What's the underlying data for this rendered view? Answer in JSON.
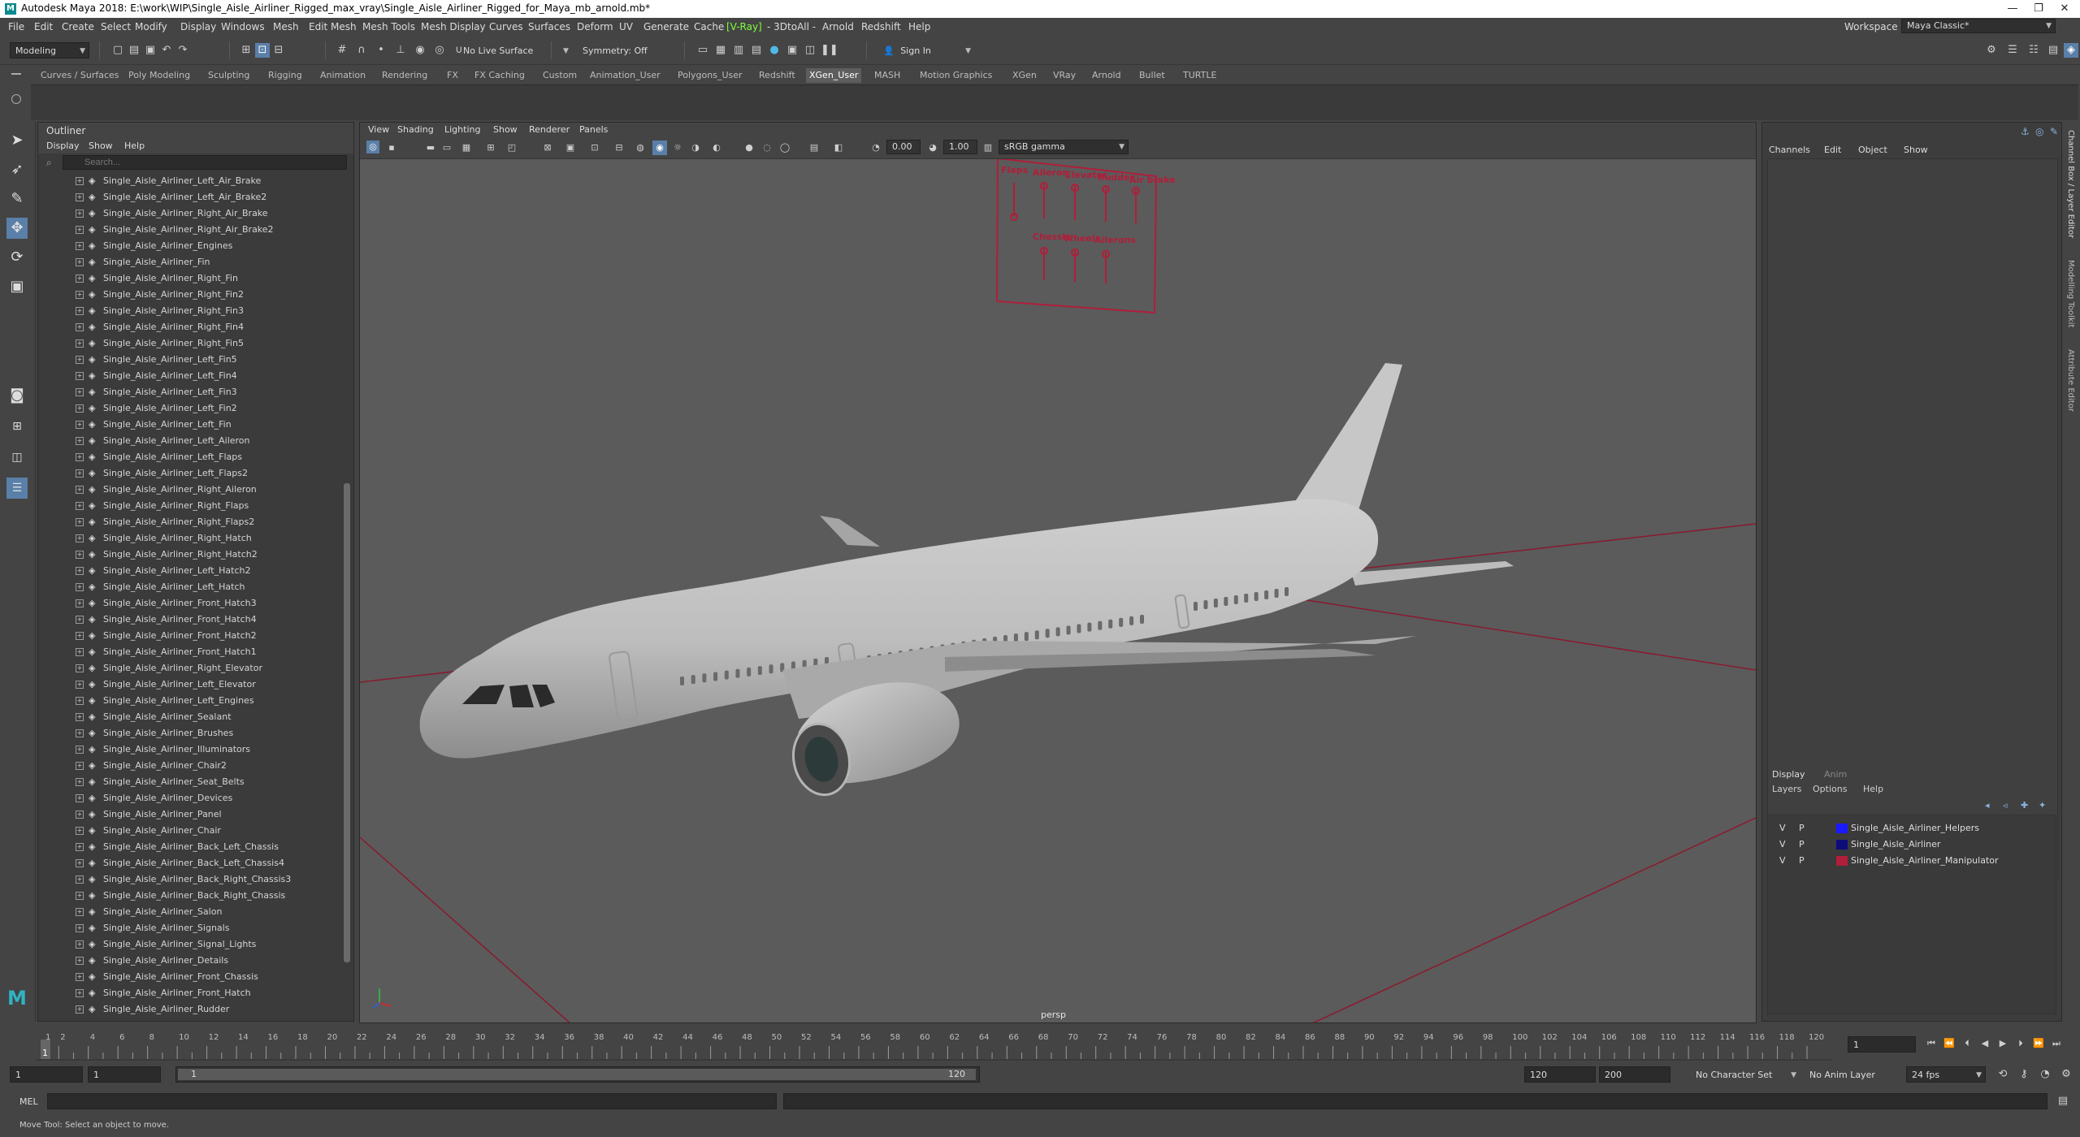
{
  "titlebar": {
    "title": "Autodesk Maya 2018: E:\\work\\WIP\\Single_Aisle_Airliner_Rigged_max_vray\\Single_Aisle_Airliner_Rigged_for_Maya_mb_arnold.mb*",
    "logo": "M",
    "minimize": "—",
    "restore": "❐",
    "close": "✕"
  },
  "menubar": {
    "items": [
      "File",
      "Edit",
      "Create",
      "Select",
      "Modify",
      "Display",
      "Windows",
      "Mesh",
      "Edit Mesh",
      "Mesh Tools",
      "Mesh Display",
      "Curves",
      "Surfaces",
      "Deform",
      "UV",
      "Generate",
      "Cache",
      "[V-Ray]",
      "- 3DtoAll -",
      "Arnold",
      "Redshift",
      "Help"
    ],
    "workspace_label": "Workspace :",
    "workspace_value": "Maya Classic*"
  },
  "statusline": {
    "mode": "Modeling",
    "live_surface": "No Live Surface",
    "symmetry": "Symmetry: Off",
    "sign_in": "Sign In"
  },
  "shelf": {
    "tabs": [
      "Curves / Surfaces",
      "Poly Modeling",
      "Sculpting",
      "Rigging",
      "Animation",
      "Rendering",
      "FX",
      "FX Caching",
      "Custom",
      "Animation_User",
      "Polygons_User",
      "Redshift",
      "XGen_User",
      "MASH",
      "Motion Graphics",
      "XGen",
      "VRay",
      "Arnold",
      "Bullet",
      "TURTLE"
    ],
    "active": "XGen_User"
  },
  "outliner": {
    "title": "Outliner",
    "menu": [
      "Display",
      "Show",
      "Help"
    ],
    "search_placeholder": "Search...",
    "items": [
      "Single_Aisle_Airliner_Left_Air_Brake",
      "Single_Aisle_Airliner_Left_Air_Brake2",
      "Single_Aisle_Airliner_Right_Air_Brake",
      "Single_Aisle_Airliner_Right_Air_Brake2",
      "Single_Aisle_Airliner_Engines",
      "Single_Aisle_Airliner_Fin",
      "Single_Aisle_Airliner_Right_Fin",
      "Single_Aisle_Airliner_Right_Fin2",
      "Single_Aisle_Airliner_Right_Fin3",
      "Single_Aisle_Airliner_Right_Fin4",
      "Single_Aisle_Airliner_Right_Fin5",
      "Single_Aisle_Airliner_Left_Fin5",
      "Single_Aisle_Airliner_Left_Fin4",
      "Single_Aisle_Airliner_Left_Fin3",
      "Single_Aisle_Airliner_Left_Fin2",
      "Single_Aisle_Airliner_Left_Fin",
      "Single_Aisle_Airliner_Left_Aileron",
      "Single_Aisle_Airliner_Left_Flaps",
      "Single_Aisle_Airliner_Left_Flaps2",
      "Single_Aisle_Airliner_Right_Aileron",
      "Single_Aisle_Airliner_Right_Flaps",
      "Single_Aisle_Airliner_Right_Flaps2",
      "Single_Aisle_Airliner_Right_Hatch",
      "Single_Aisle_Airliner_Right_Hatch2",
      "Single_Aisle_Airliner_Left_Hatch2",
      "Single_Aisle_Airliner_Left_Hatch",
      "Single_Aisle_Airliner_Front_Hatch3",
      "Single_Aisle_Airliner_Front_Hatch4",
      "Single_Aisle_Airliner_Front_Hatch2",
      "Single_Aisle_Airliner_Front_Hatch1",
      "Single_Aisle_Airliner_Right_Elevator",
      "Single_Aisle_Airliner_Left_Elevator",
      "Single_Aisle_Airliner_Left_Engines",
      "Single_Aisle_Airliner_Sealant",
      "Single_Aisle_Airliner_Brushes",
      "Single_Aisle_Airliner_Illuminators",
      "Single_Aisle_Airliner_Chair2",
      "Single_Aisle_Airliner_Seat_Belts",
      "Single_Aisle_Airliner_Devices",
      "Single_Aisle_Airliner_Panel",
      "Single_Aisle_Airliner_Chair",
      "Single_Aisle_Airliner_Back_Left_Chassis",
      "Single_Aisle_Airliner_Back_Left_Chassis4",
      "Single_Aisle_Airliner_Back_Right_Chassis3",
      "Single_Aisle_Airliner_Back_Right_Chassis",
      "Single_Aisle_Airliner_Salon",
      "Single_Aisle_Airliner_Signals",
      "Single_Aisle_Airliner_Signal_Lights",
      "Single_Aisle_Airliner_Details",
      "Single_Aisle_Airliner_Front_Chassis",
      "Single_Aisle_Airliner_Front_Hatch",
      "Single_Aisle_Airliner_Rudder"
    ]
  },
  "viewport": {
    "menu": [
      "View",
      "Shading",
      "Lighting",
      "Show",
      "Renderer",
      "Panels"
    ],
    "exposure": "0.00",
    "gamma": "1.00",
    "color_space": "sRGB gamma",
    "camera": "persp",
    "control_panel": {
      "top_labels": [
        "Flaps",
        "Aileron",
        "Elevator",
        "Rudder",
        "Air brake"
      ],
      "bottom_labels": [
        "Chassis",
        "Wheels",
        "Ailerons"
      ]
    }
  },
  "channelbox": {
    "menu": [
      "Channels",
      "Edit",
      "Object",
      "Show"
    ],
    "layer_tabs": [
      "Display",
      "Anim"
    ],
    "layer_menu": [
      "Layers",
      "Options",
      "Help"
    ],
    "layers": [
      {
        "v": "V",
        "p": "P",
        "color": "#1a1aff",
        "name": "Single_Aisle_Airliner_Helpers"
      },
      {
        "v": "V",
        "p": "P",
        "color": "#0d0d7a",
        "name": "Single_Aisle_Airliner"
      },
      {
        "v": "V",
        "p": "P",
        "color": "#b01e3a",
        "name": "Single_Aisle_Airliner_Manipulator"
      }
    ],
    "side_tabs": [
      "Channel Box / Layer Editor",
      "Modelling Toolkit",
      "Attribute Editor"
    ]
  },
  "timeslider": {
    "ticks": [
      "1",
      "2",
      "4",
      "6",
      "8",
      "10",
      "12",
      "14",
      "16",
      "18",
      "20",
      "22",
      "24",
      "26",
      "28",
      "30",
      "32",
      "34",
      "36",
      "38",
      "40",
      "42",
      "44",
      "46",
      "48",
      "50",
      "52",
      "54",
      "56",
      "58",
      "60",
      "62",
      "64",
      "66",
      "68",
      "70",
      "72",
      "74",
      "76",
      "78",
      "80",
      "82",
      "84",
      "86",
      "88",
      "90",
      "92",
      "94",
      "96",
      "98",
      "100",
      "102",
      "104",
      "106",
      "108",
      "110",
      "112",
      "114",
      "116",
      "118",
      "120"
    ],
    "current_frame": "1"
  },
  "range": {
    "start": "1",
    "playback_start": "1",
    "slider_start": "1",
    "slider_end": "120",
    "playback_end": "120",
    "end": "200",
    "character_set": "No Character Set",
    "anim_layer": "No Anim Layer",
    "fps": "24 fps"
  },
  "command": {
    "label": "MEL"
  },
  "help_line": "Move Tool: Select an object to move.",
  "colors": {
    "viewport_bg": "#5b5b5b",
    "grid_axis": "#8a1a2e",
    "accent": "#5a7fa8",
    "vray_green": "#7cff3a"
  }
}
